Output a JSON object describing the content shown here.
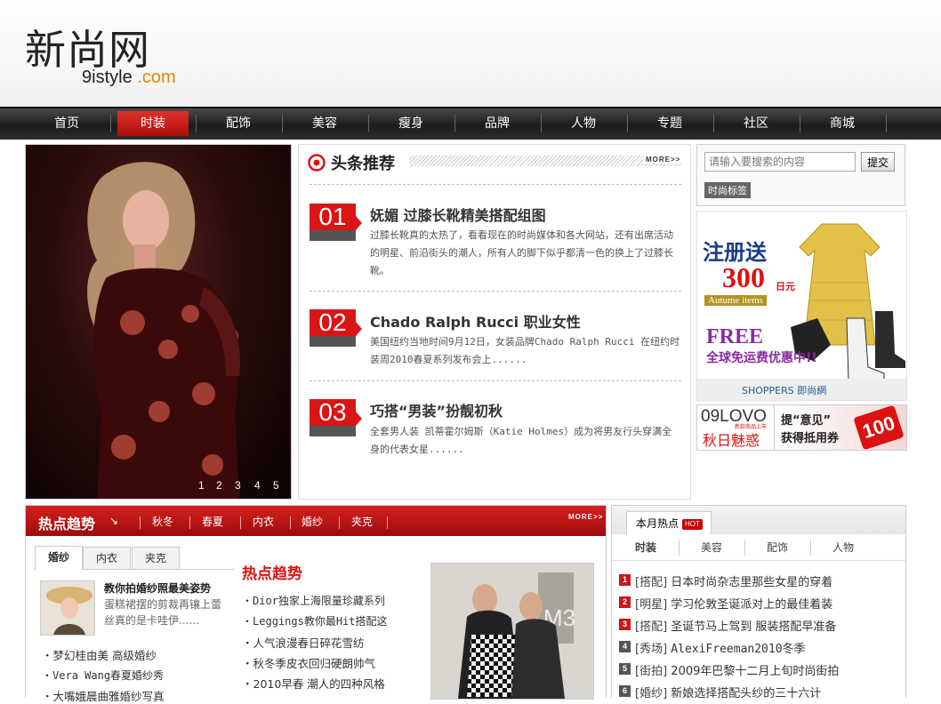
{
  "logo": {
    "chinese": "新尚网",
    "english_prefix": "9istyle",
    "english_suffix": ".com"
  },
  "nav": {
    "items": [
      "首页",
      "时装",
      "配饰",
      "美容",
      "瘦身",
      "品牌",
      "人物",
      "专题",
      "社区",
      "商城"
    ],
    "active_index": 1
  },
  "hero": {
    "pager": [
      "1",
      "2",
      "3",
      "4",
      "5"
    ]
  },
  "headline": {
    "title": "头条推荐",
    "more": "MORE>>",
    "items": [
      {
        "num": "01",
        "title": "妩媚 过膝长靴精美搭配组图",
        "body": "过膝长靴真的太热了，看看现在的时尚媒体和各大网站，还有出席活动的明星、前沿街头的潮人，所有人的脚下似乎都清一色的换上了过膝长靴。"
      },
      {
        "num": "02",
        "title": "Chado Ralph Rucci 职业女性",
        "body": "美国纽约当地时间9月12日，女装品牌Chado Ralph Rucci 在纽约时装周2010春夏系列发布会上......"
      },
      {
        "num": "03",
        "title": "巧搭“男装”扮靓初秋",
        "body": "全套男人装 凯蒂霍尔姆斯（Katie Holmes）成为将男友行头穿满全身的代表女星......"
      }
    ]
  },
  "search": {
    "placeholder": "请输入要搜索的内容",
    "button": "提交",
    "tag_label": "时尚标签"
  },
  "ad1": {
    "line1": "注册送",
    "amount": "300",
    "unit": "日元",
    "sub": "Autume items",
    "free": "FREE",
    "free_sub": "全球免运费优惠中!!",
    "brand": "SHOPPERS 即尚網"
  },
  "ad2": {
    "left_top": "09LOVO",
    "left_sub": "新款商品上市",
    "left_bottom": "秋日魅惑",
    "right_top": "提“意见”",
    "right_bottom": "获得抵用券",
    "badge": "100"
  },
  "trend": {
    "title": "热点趋势",
    "arrow": "↘",
    "tabs": [
      "秋冬",
      "春夏",
      "内衣",
      "婚纱",
      "夹克"
    ],
    "more": "MORE>>",
    "wedding_tabs": [
      "婚纱",
      "内衣",
      "夹克"
    ],
    "feature_title": "教你拍婚纱照最美姿势",
    "feature_desc": "蛋糕裙摆的剪裁再镶上蕾丝真的是卡哇伊......",
    "wedding_list": [
      "梦幻桂由美 高级婚纱",
      "Vera Wang春夏婚纱秀",
      "大嘴娥晨曲雅婚纱写真"
    ],
    "hot_title": "热点趋势",
    "hot_list": [
      "Dior独家上海限量珍藏系列",
      "Leggings教你最Hit搭配这",
      "人气浪漫春日碎花雪纺",
      "秋冬季皮衣回归硬朗帅气",
      "2010早春 潮人的四种风格"
    ]
  },
  "month": {
    "tab": "本月热点",
    "hot": "HOT",
    "subtabs": [
      "时装",
      "美容",
      "配饰",
      "人物"
    ],
    "items": [
      {
        "rank": "1",
        "cat": "[搭配]",
        "text": "日本时尚杂志里那些女星的穿着"
      },
      {
        "rank": "2",
        "cat": "[明星]",
        "text": "学习伦敦圣诞派对上的最佳着装"
      },
      {
        "rank": "3",
        "cat": "[搭配]",
        "text": "圣诞节马上驾到 服装搭配早准备"
      },
      {
        "rank": "4",
        "cat": "[秀场]",
        "text": "AlexiFreeman2010冬季"
      },
      {
        "rank": "5",
        "cat": "[街拍]",
        "text": "2009年巴黎十二月上旬时尚街拍"
      },
      {
        "rank": "6",
        "cat": "[婚纱]",
        "text": "新娘选择搭配头纱的三十六计"
      }
    ],
    "rank_colors": [
      "#c91818",
      "#c91818",
      "#c91818",
      "#555555",
      "#555555",
      "#555555"
    ]
  }
}
